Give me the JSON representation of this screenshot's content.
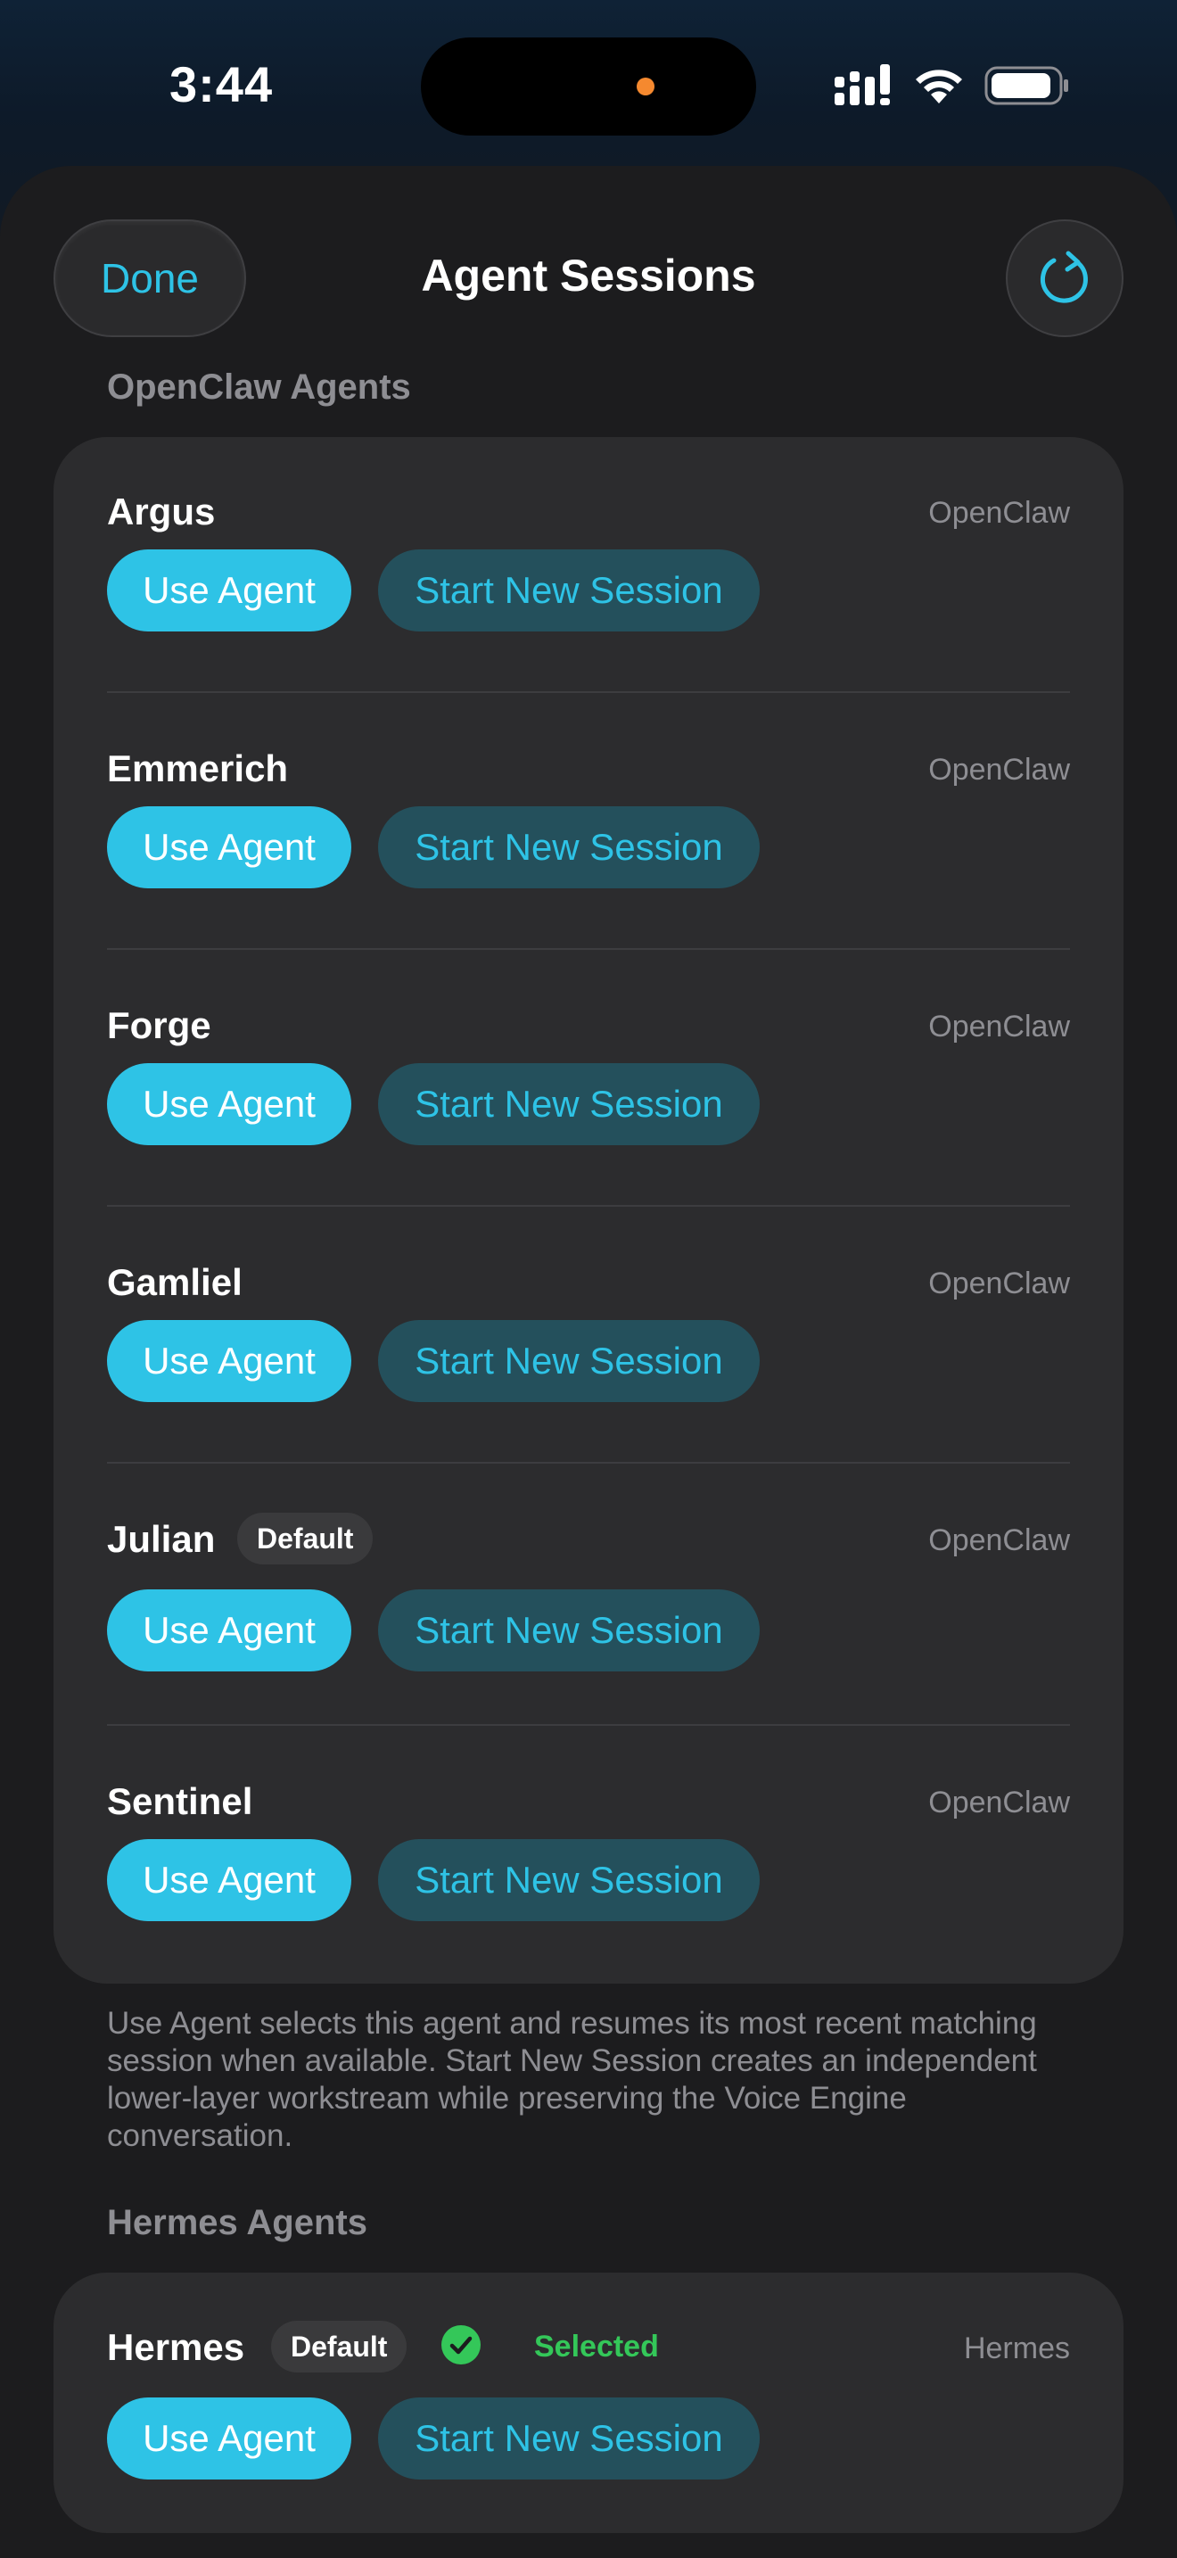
{
  "status_bar": {
    "time": "3:44"
  },
  "nav": {
    "done_label": "Done",
    "title": "Agent Sessions"
  },
  "openclaw_section": {
    "header": "OpenClaw Agents",
    "agents": [
      {
        "name": "Argus",
        "provider": "OpenClaw",
        "use_label": "Use Agent",
        "new_label": "Start New Session"
      },
      {
        "name": "Emmerich",
        "provider": "OpenClaw",
        "use_label": "Use Agent",
        "new_label": "Start New Session"
      },
      {
        "name": "Forge",
        "provider": "OpenClaw",
        "use_label": "Use Agent",
        "new_label": "Start New Session"
      },
      {
        "name": "Gamliel",
        "provider": "OpenClaw",
        "use_label": "Use Agent",
        "new_label": "Start New Session"
      },
      {
        "name": "Julian",
        "badge": "Default",
        "provider": "OpenClaw",
        "use_label": "Use Agent",
        "new_label": "Start New Session"
      },
      {
        "name": "Sentinel",
        "provider": "OpenClaw",
        "use_label": "Use Agent",
        "new_label": "Start New Session"
      }
    ],
    "footer": "Use Agent selects this agent and resumes its most recent matching session when available. Start New Session creates an independent lower-layer workstream while preserving the Voice Engine conversation."
  },
  "hermes_section": {
    "header": "Hermes Agents",
    "agents": [
      {
        "name": "Hermes",
        "badge": "Default",
        "status": "Selected",
        "provider": "Hermes",
        "use_label": "Use Agent",
        "new_label": "Start New Session"
      }
    ]
  },
  "colors": {
    "accent": "#2ec3e6",
    "accent_dim": "#24505c",
    "selected_green": "#34c759",
    "card": "#2c2c2e",
    "background": "#1c1c1e"
  },
  "icons": [
    "signal-icon",
    "wifi-icon",
    "battery-icon",
    "refresh-icon",
    "checkmark-circle-icon"
  ]
}
